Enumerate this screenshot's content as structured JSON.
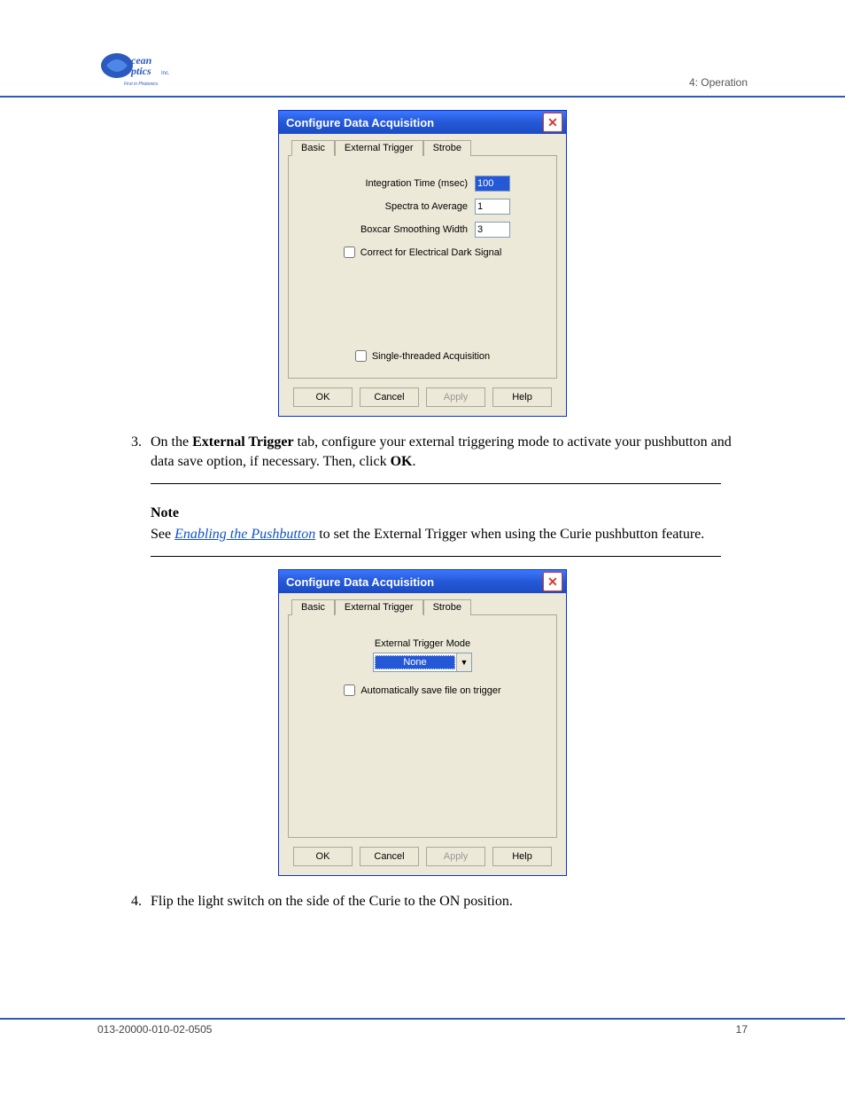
{
  "header": {
    "chapter": "4: Operation"
  },
  "dialog1": {
    "title": "Configure Data Acquisition",
    "tabs": {
      "basic": "Basic",
      "external": "External Trigger",
      "strobe": "Strobe"
    },
    "fields": {
      "integration_label": "Integration Time (msec)",
      "integration_value": "100",
      "spectra_label": "Spectra to Average",
      "spectra_value": "1",
      "boxcar_label": "Boxcar Smoothing Width",
      "boxcar_value": "3",
      "dark_label": "Correct for Electrical Dark Signal",
      "single_label": "Single-threaded Acquisition"
    },
    "buttons": {
      "ok": "OK",
      "cancel": "Cancel",
      "apply": "Apply",
      "help": "Help"
    }
  },
  "step3": {
    "num": "3.",
    "a": "On the ",
    "tab": "External Trigger",
    "b": " tab, configure your external triggering mode to activate your pushbutton and data save option, if necessary. Then, click ",
    "ok": "OK",
    "c": "."
  },
  "note": {
    "title": "Note",
    "a": "See ",
    "link": "Enabling the Pushbutton",
    "b": " to set the External Trigger when using the Curie pushbutton feature."
  },
  "dialog2": {
    "title": "Configure Data Acquisition",
    "tabs": {
      "basic": "Basic",
      "external": "External Trigger",
      "strobe": "Strobe"
    },
    "mode_label": "External Trigger Mode",
    "mode_value": "None",
    "auto_label": "Automatically save file on trigger",
    "buttons": {
      "ok": "OK",
      "cancel": "Cancel",
      "apply": "Apply",
      "help": "Help"
    }
  },
  "step4": {
    "num": "4.",
    "text": "Flip the light switch on the side of the Curie to the ON position."
  },
  "footer": {
    "doc": "013-20000-010-02-0505",
    "page": "17"
  }
}
